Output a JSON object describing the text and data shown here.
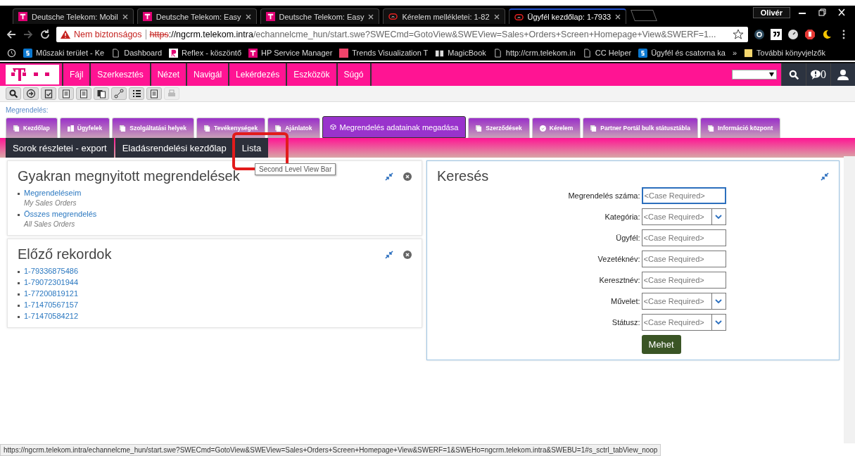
{
  "browser": {
    "tabs": [
      {
        "title": "Deutsche Telekom: Mobil",
        "kind": "telekom",
        "selected": false
      },
      {
        "title": "Deutsche Telekom: Easy",
        "kind": "telekom",
        "selected": false
      },
      {
        "title": "Deutsche Telekom: Easy",
        "kind": "telekom",
        "selected": false
      },
      {
        "title": "Kérelem mellékletei: 1-82",
        "kind": "siebel",
        "selected": false
      },
      {
        "title": "Ügyfél kezdőlap: 1-7933",
        "kind": "siebel",
        "selected": true
      }
    ],
    "profile": "Olivér",
    "address": {
      "warning": "Nem biztonságos",
      "scheme": "https",
      "host": "://ngcrm.telekom.intra",
      "path": "/echannelcme_hun/start.swe?SWECmd=GotoView&SWEView=Sales+Orders+Screen+Homepage+View&SWERF=1..."
    },
    "bookmarks": [
      {
        "label": "Műszaki terület - Ke",
        "kind": "sharepoint"
      },
      {
        "label": "Dashboard",
        "kind": "page"
      },
      {
        "label": "Reflex - köszöntő",
        "kind": "reflex"
      },
      {
        "label": "HP Service Manager",
        "kind": "telekom"
      },
      {
        "label": "Trends Visualization T",
        "kind": "square"
      },
      {
        "label": "MagicBook",
        "kind": "magicbook"
      },
      {
        "label": "http://crm.telekom.in",
        "kind": "page"
      },
      {
        "label": "CC Helper",
        "kind": "page"
      },
      {
        "label": "Ügyfél és csatorna ka",
        "kind": "sharepoint"
      }
    ],
    "more": "»",
    "other_bookmarks": "További könyvjelzők"
  },
  "app": {
    "menu": [
      "Fájl",
      "Szerkesztés",
      "Nézet",
      "Navigál",
      "Lekérdezés",
      "Eszközök",
      "Súgó"
    ],
    "notification_count": "0",
    "toolbar": [
      {
        "kind": "search",
        "disabled": false
      },
      {
        "kind": "go",
        "disabled": false
      },
      {
        "kind": "check",
        "disabled": false
      },
      {
        "kind": "clip",
        "disabled": false
      },
      {
        "kind": "clip",
        "disabled": false
      },
      {
        "kind": "copy",
        "disabled": false
      },
      {
        "kind": "link",
        "disabled": false
      },
      {
        "kind": "list",
        "disabled": false
      },
      {
        "kind": "clip",
        "disabled": false
      },
      {
        "kind": "print",
        "disabled": true
      }
    ],
    "breadcrumb": "Megrendelés:",
    "tabs": [
      {
        "label": "Kezdőlap",
        "kind": "page",
        "selected": false
      },
      {
        "label": "Ügyfelek",
        "kind": "building",
        "selected": false
      },
      {
        "label": "Szolgáltatási helyek",
        "kind": "page",
        "selected": false
      },
      {
        "label": "Tevékenységek",
        "kind": "page",
        "selected": false
      },
      {
        "label": "Ajánlatok",
        "kind": "page",
        "selected": false
      },
      {
        "label": "Megrendelés adatainak megadása",
        "kind": "box",
        "selected": true
      },
      {
        "label": "Szerződések",
        "kind": "page",
        "selected": false
      },
      {
        "label": "Kérelem",
        "kind": "circle",
        "selected": false
      },
      {
        "label": "Partner Portál bulk státusztábla",
        "kind": "page",
        "selected": false
      },
      {
        "label": "Információ központ",
        "kind": "page",
        "selected": false
      }
    ],
    "view_bar": [
      {
        "label": "Sorok részletei - export",
        "highlighted": false
      },
      {
        "label": "Eladásrendelési kezdőlap",
        "highlighted": false
      },
      {
        "label": "Lista",
        "highlighted": true
      }
    ],
    "tooltip": "Second Level View Bar",
    "frequent": {
      "title": "Gyakran megnyitott megrendelések",
      "items": [
        {
          "link": "Megrendeléseim",
          "subtitle": "My Sales Orders"
        },
        {
          "link": "Összes megrendelés",
          "subtitle": "All Sales Orders"
        }
      ]
    },
    "previous": {
      "title": "Előző rekordok",
      "items": [
        "1-79336875486",
        "1-79072301944",
        "1-77200819121",
        "1-71470567157",
        "1-71470584212"
      ]
    },
    "search": {
      "title": "Keresés",
      "fields": [
        {
          "label": "Megrendelés száma:",
          "placeholder": "<Case Required>",
          "kind": "text",
          "focused": true
        },
        {
          "label": "Kategória:",
          "placeholder": "<Case Required>",
          "kind": "dropdown",
          "focused": false
        },
        {
          "label": "Ügyfél:",
          "placeholder": "<Case Required>",
          "kind": "text",
          "focused": false
        },
        {
          "label": "Vezetéknév:",
          "placeholder": "<Case Required>",
          "kind": "text",
          "focused": false
        },
        {
          "label": "Keresztnév:",
          "placeholder": "<Case Required>",
          "kind": "text",
          "focused": false
        },
        {
          "label": "Művelet:",
          "placeholder": "<Case Required>",
          "kind": "dropdown",
          "focused": false
        },
        {
          "label": "Státusz:",
          "placeholder": "<Case Required>",
          "kind": "dropdown",
          "focused": false
        }
      ],
      "button": "Mehet"
    },
    "status_url": "https://ngcrm.telekom.intra/echannelcme_hun/start.swe?SWECmd=GotoView&SWEView=Sales+Orders+Screen+Homepage+View&SWERF=1&SWEHo=ngcrm.telekom.intra&SWEBU=1#s_sctrl_tabView_noop"
  }
}
